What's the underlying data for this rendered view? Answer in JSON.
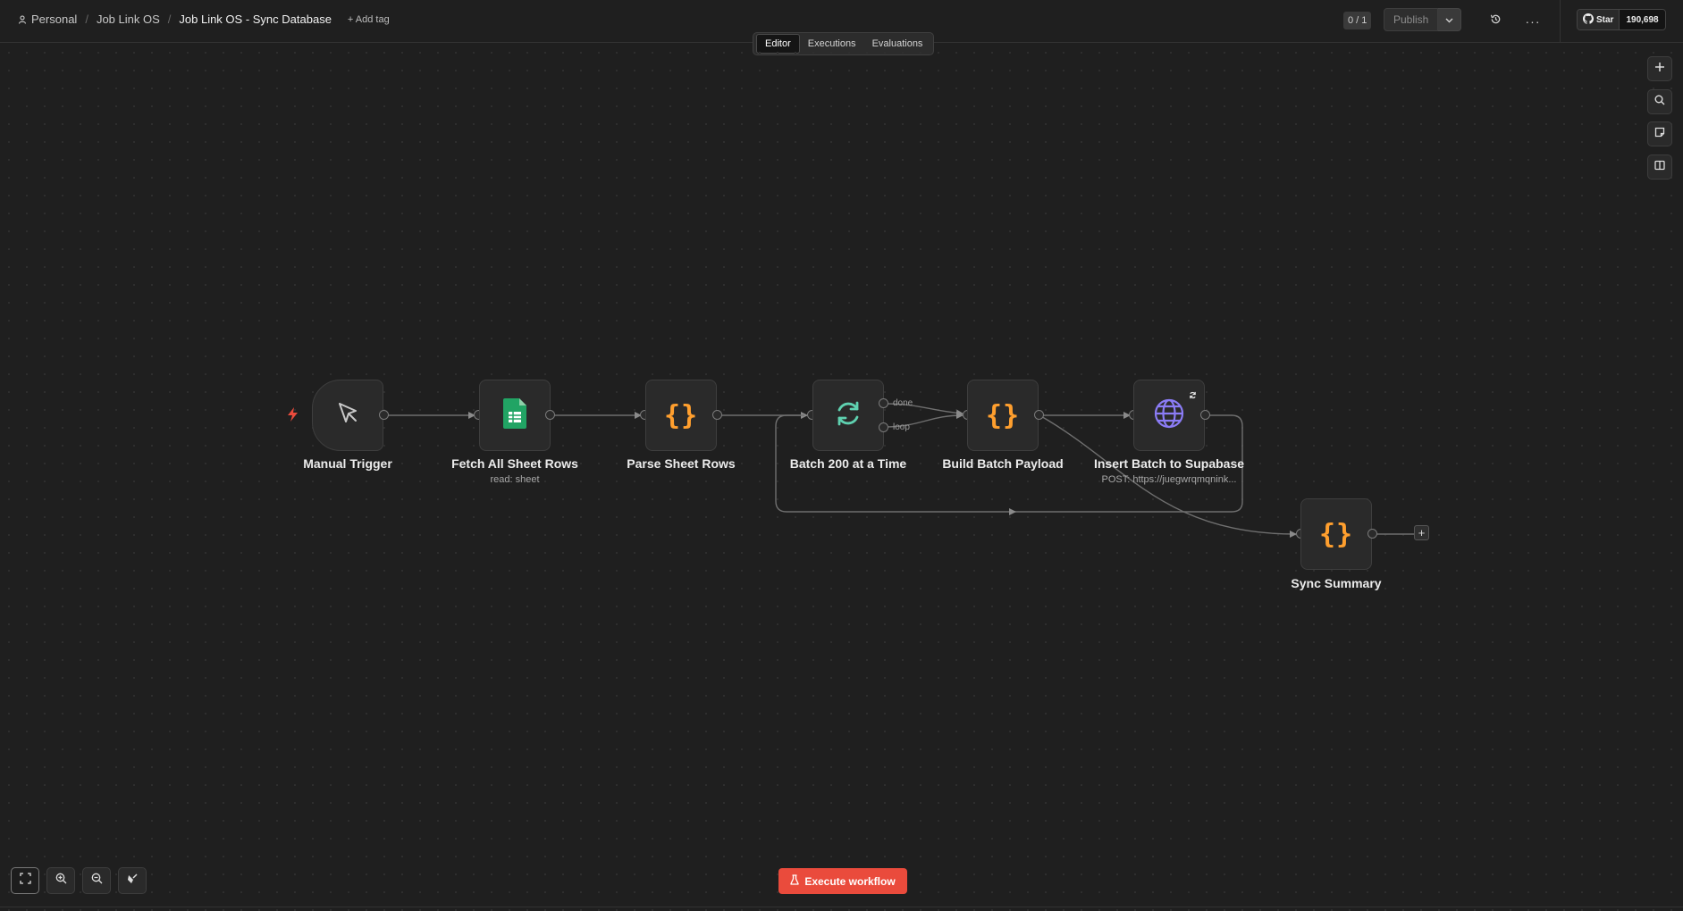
{
  "breadcrumb": {
    "personal": "Personal",
    "project": "Job Link OS",
    "workflow": "Job Link OS - Sync Database",
    "add_tag": "+ Add tag"
  },
  "header": {
    "counter": "0 / 1",
    "publish_label": "Publish",
    "more_label": "···",
    "github": {
      "star_label": "Star",
      "star_count": "190,698"
    }
  },
  "tabs": [
    "Editor",
    "Executions",
    "Evaluations"
  ],
  "nodes": [
    {
      "label": "Manual Trigger",
      "sub": "",
      "icon": "cursor-icon"
    },
    {
      "label": "Fetch All Sheet Rows",
      "sub": "read: sheet",
      "icon": "google-sheets-icon"
    },
    {
      "label": "Parse Sheet Rows",
      "sub": "",
      "icon": "code-icon",
      "icon_text": "{}"
    },
    {
      "label": "Batch 200 at a Time",
      "sub": "",
      "icon": "loop-icon"
    },
    {
      "label": "Build Batch Payload",
      "sub": "",
      "icon": "code-icon",
      "icon_text": "{}"
    },
    {
      "label": "Insert Batch to Supabase",
      "sub": "POST: https://juegwrqmqnink...",
      "icon": "globe-icon"
    },
    {
      "label": "Sync Summary",
      "sub": "",
      "icon": "code-icon",
      "icon_text": "{}"
    }
  ],
  "port_labels": {
    "done": "done",
    "loop": "loop"
  },
  "add_node_label": "+",
  "execute_button": "Execute workflow",
  "colors": {
    "accent": "#ea4b3c",
    "code_icon": "#ff9f2e",
    "loop_icon": "#5fd1b0",
    "globe_icon": "#8b7cf6",
    "sheets_icon": "#21a464"
  }
}
